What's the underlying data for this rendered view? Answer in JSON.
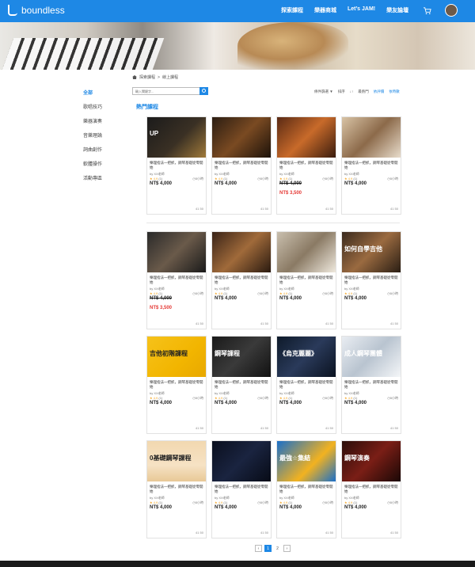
{
  "app": {
    "logo_text": "boundless",
    "nav": [
      "探索課程",
      "樂器商城",
      "Let’s JAM!",
      "樂友論壇"
    ],
    "accent": "#1e88e5"
  },
  "breadcrumb": [
    "探索課程",
    "線上課程"
  ],
  "sidebar": {
    "items": [
      "全部",
      "歌唱技巧",
      "樂器演奏",
      "音樂理論",
      "詞曲創作",
      "軟體操作",
      "活動專區"
    ],
    "active_index": 0
  },
  "search": {
    "placeholder": "輸入關鍵字..."
  },
  "toolbar": {
    "filter_label": "條件篩選",
    "sort_label": "排序",
    "sort_options": [
      "最熱門",
      "依評價",
      "依時數"
    ]
  },
  "section_title": "熱門課程",
  "card_defaults": {
    "title": "樂理指法一把抓，鋼琴基礎從零開始",
    "by": "by XX老師",
    "rating": "4.9",
    "reviews": "(1)",
    "duration": "5小時",
    "price": "NT$ 4,000",
    "count": "41 50"
  },
  "cards": [
    {
      "thumb_text": "UP",
      "sale": ""
    },
    {
      "thumb_text": "",
      "sale": ""
    },
    {
      "thumb_text": "",
      "sale": "NT$ 3,500"
    },
    {
      "thumb_text": "",
      "sale": ""
    },
    {
      "thumb_text": "",
      "sale": "NT$ 3,500"
    },
    {
      "thumb_text": "",
      "sale": ""
    },
    {
      "thumb_text": "",
      "sale": ""
    },
    {
      "thumb_text": "如何自學吉他",
      "sale": ""
    },
    {
      "thumb_text": "吉他初階課程",
      "sale": ""
    },
    {
      "thumb_text": "鋼琴課程",
      "sale": ""
    },
    {
      "thumb_text": "《烏克麗麗》",
      "sale": ""
    },
    {
      "thumb_text": "成人鋼琴團體",
      "sale": ""
    },
    {
      "thumb_text": "0基礎鋼琴課程",
      "sale": ""
    },
    {
      "thumb_text": "",
      "sale": ""
    },
    {
      "thumb_text": "最強☆集結",
      "sale": ""
    },
    {
      "thumb_text": "鋼琴演奏",
      "sale": ""
    }
  ],
  "pagination": {
    "pages": [
      "1",
      "2"
    ],
    "current": "1"
  }
}
